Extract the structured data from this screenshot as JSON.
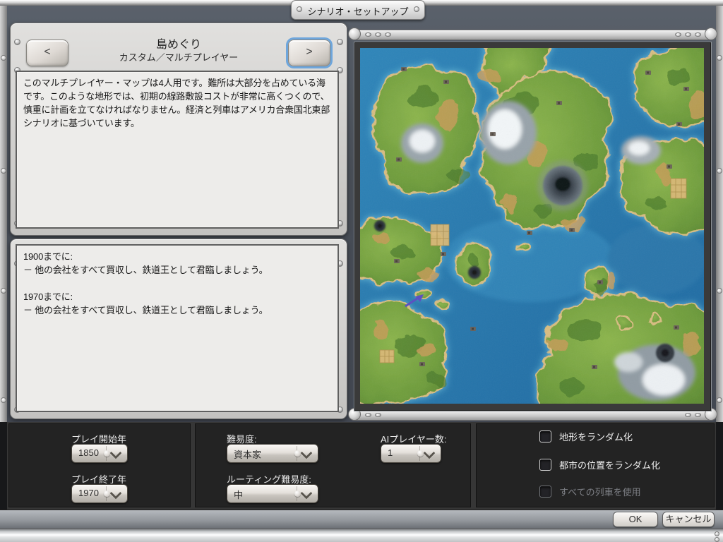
{
  "window": {
    "title_tab": "シナリオ・セットアップ"
  },
  "scenario": {
    "title": "島めぐり",
    "subtitle": "カスタム／マルチプレイヤー",
    "prev_label": "<",
    "next_label": ">",
    "description": "このマルチプレイヤー・マップは4人用です。難所は大部分を占めている海です。このような地形では、初期の線路敷設コストが非常に高くつくので、慎重に計画を立てなければなりません。経済と列車はアメリカ合衆国北東部シナリオに基づいています。",
    "goals": "1900までに:\n－ 他の会社をすべて買収し、鉄道王として君臨しましょう。\n\n1970までに:\n－ 他の会社をすべて買収し、鉄道王として君臨しましょう。"
  },
  "settings": {
    "start_year": {
      "label": "プレイ開始年",
      "value": "1850"
    },
    "end_year": {
      "label": "プレイ終了年",
      "value": "1970"
    },
    "difficulty": {
      "label": "難易度:",
      "value": "資本家"
    },
    "routing_difficulty": {
      "label": "ルーティング難易度:",
      "value": "中"
    },
    "ai_players": {
      "label": "AIプレイヤー数:",
      "value": "1"
    },
    "checkboxes": [
      {
        "label": "地形をランダム化",
        "checked": false,
        "enabled": true
      },
      {
        "label": "都市の位置をランダム化",
        "checked": false,
        "enabled": true
      },
      {
        "label": "すべての列車を使用",
        "checked": false,
        "enabled": false
      }
    ]
  },
  "footer": {
    "ok_label": "OK",
    "cancel_label": "キャンセル"
  },
  "colors": {
    "focus_ring": "#6ea6dc",
    "panel_metal": "#d6d4d1",
    "window_bg": "#4a5058",
    "control_bar_bg": "#232323",
    "map_water": "#2a7cb4",
    "map_land": "#6e9c3c"
  }
}
